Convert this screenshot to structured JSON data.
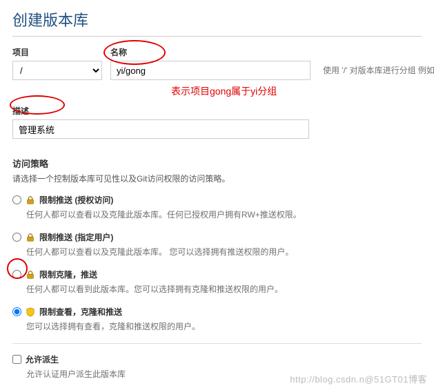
{
  "header": {
    "title": "创建版本库"
  },
  "form": {
    "project": {
      "label": "项目",
      "value": "/"
    },
    "name": {
      "label": "名称",
      "value": "yi/gong"
    },
    "hint": "使用 '/' 对版本库进行分组  例如",
    "annotation": "表示项目gong属于yi分组",
    "description": {
      "label": "描述",
      "value": "管理系统"
    }
  },
  "access": {
    "title": "访问策略",
    "sub": "请选择一个控制版本库可见性以及Git访问权限的访问策略。",
    "options": [
      {
        "label": "限制推送 (授权访问)",
        "desc": "任何人都可以查看以及克隆此版本库。任何已授权用户拥有RW+推送权限。",
        "icon": "lock"
      },
      {
        "label": "限制推送 (指定用户)",
        "desc": "任何人都可以查看以及克隆此版本库。 您可以选择拥有推送权限的用户。",
        "icon": "lock"
      },
      {
        "label": "限制克隆，推送",
        "desc": "任何人都可以看到此版本库。您可以选择拥有克隆和推送权限的用户。",
        "icon": "lock"
      },
      {
        "label": "限制查看，克隆和推送",
        "desc": "您可以选择拥有查看，克隆和推送权限的用户。",
        "icon": "shield"
      }
    ],
    "selected": 3
  },
  "fork": {
    "label": "允许派生",
    "desc": "允许认证用户派生此版本库"
  },
  "watermark": "http://blog.csdn.n@51GT01博客"
}
